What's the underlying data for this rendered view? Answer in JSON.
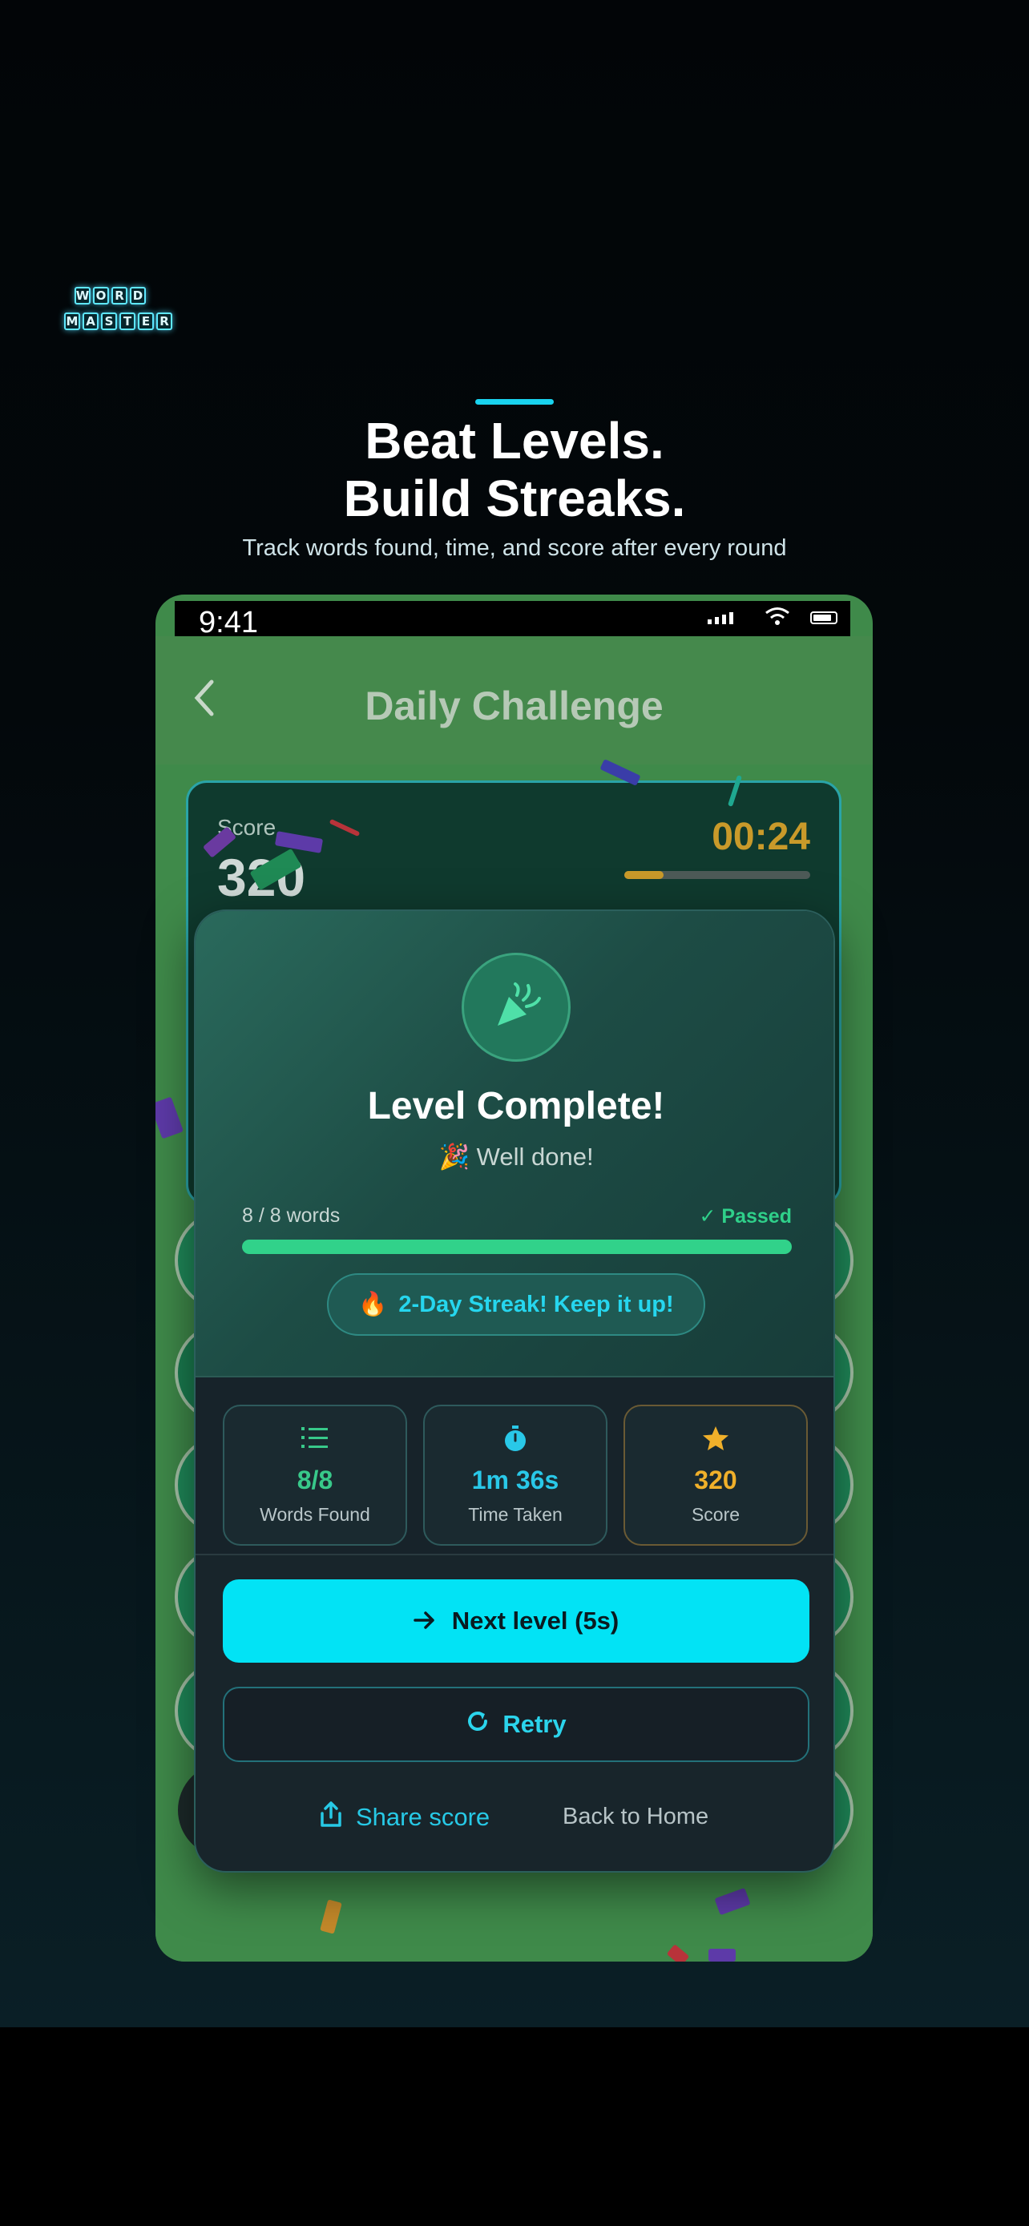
{
  "promo": {
    "logo_line1": [
      "W",
      "O",
      "R",
      "D"
    ],
    "logo_line2": [
      "M",
      "A",
      "S",
      "T",
      "E",
      "R"
    ],
    "headline_line1": "Beat Levels.",
    "headline_line2": "Build Streaks.",
    "subtitle": "Track words found, time, and score after every round"
  },
  "status_bar": {
    "time": "9:41"
  },
  "app": {
    "title": "Daily Challenge",
    "score_label": "Score",
    "score_value": "320",
    "timer": "00:24",
    "timer_progress": 0.21
  },
  "modal": {
    "title": "Level Complete!",
    "subtitle": "🎉 Well done!",
    "progress_text": "8 / 8 words",
    "progress_status": "✓ Passed",
    "progress_fraction": 1.0,
    "streak_emoji": "🔥",
    "streak_text": "2-Day Streak! Keep it up!",
    "stats": [
      {
        "icon": "list-icon",
        "value": "8/8",
        "label": "Words Found",
        "color": "#38c98a"
      },
      {
        "icon": "stopwatch-icon",
        "value": "1m 36s",
        "label": "Time Taken",
        "color": "#29c8e8"
      },
      {
        "icon": "star-icon",
        "value": "320",
        "label": "Score",
        "color": "#f0b02a"
      }
    ],
    "next_label": "Next level (5s)",
    "retry_label": "Retry",
    "share_label": "Share score",
    "home_label": "Back to Home"
  },
  "colors": {
    "accent_cyan": "#02e3f5",
    "success_green": "#31d28a",
    "gold": "#f0b02a"
  }
}
